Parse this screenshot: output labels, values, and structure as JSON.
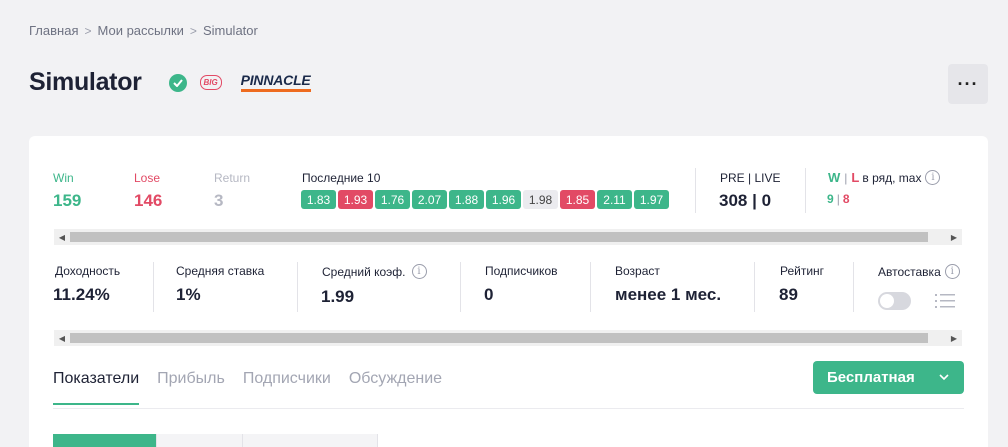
{
  "breadcrumb": [
    "Главная",
    "Мои рассылки",
    "Simulator"
  ],
  "title": "Simulator",
  "badges": {
    "big": "BIG",
    "bookmaker": "PINNACLE",
    "verified_icon": "check-circle-icon"
  },
  "more_label": "···",
  "stats": {
    "win": {
      "label": "Win",
      "value": "159"
    },
    "lose": {
      "label": "Lose",
      "value": "146"
    },
    "return": {
      "label": "Return",
      "value": "3"
    }
  },
  "last10": {
    "label": "Последние 10",
    "items": [
      {
        "v": "1.83",
        "s": "g"
      },
      {
        "v": "1.93",
        "s": "r"
      },
      {
        "v": "1.76",
        "s": "g"
      },
      {
        "v": "2.07",
        "s": "g"
      },
      {
        "v": "1.88",
        "s": "g"
      },
      {
        "v": "1.96",
        "s": "g"
      },
      {
        "v": "1.98",
        "s": "n"
      },
      {
        "v": "1.85",
        "s": "r"
      },
      {
        "v": "2.11",
        "s": "g"
      },
      {
        "v": "1.97",
        "s": "g"
      }
    ]
  },
  "prelive": {
    "label": "PRE | LIVE",
    "value": "308 | 0"
  },
  "streak": {
    "w": "W",
    "l": "L",
    "label": "в ряд, max",
    "w_val": "9",
    "l_val": "8"
  },
  "metrics": {
    "yield": {
      "label": "Доходность",
      "value": "11.24%"
    },
    "avg_stake": {
      "label": "Средняя ставка",
      "value": "1%"
    },
    "avg_odds": {
      "label": "Средний коэф.",
      "value": "1.99"
    },
    "subscribers": {
      "label": "Подписчиков",
      "value": "0"
    },
    "age": {
      "label": "Возраст",
      "value": "менее 1 мес."
    },
    "rating": {
      "label": "Рейтинг",
      "value": "89"
    },
    "autobet": {
      "label": "Автоставка"
    }
  },
  "tabs": [
    "Показатели",
    "Прибыль",
    "Подписчики",
    "Обсуждение"
  ],
  "free_button": "Бесплатная",
  "colors": {
    "accent": "#3db68a",
    "danger": "#e24a65",
    "text": "#1e2235"
  }
}
